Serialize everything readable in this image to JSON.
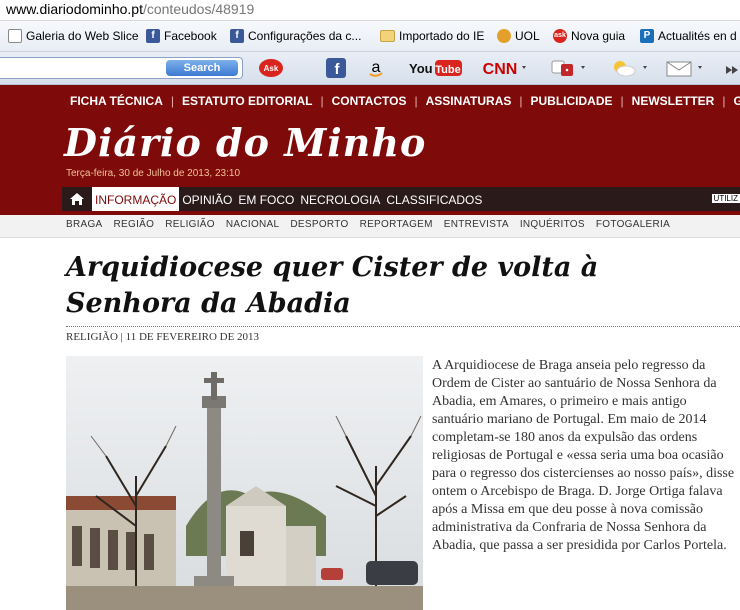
{
  "browser": {
    "url_domain": "www.diariodominho.pt",
    "url_path": "/conteudos/48919",
    "favorites": [
      {
        "label": "Galeria do Web Slice",
        "icon": "web-slice-icon"
      },
      {
        "label": "Facebook",
        "icon": "facebook-icon"
      },
      {
        "label": "Configurações da c...",
        "icon": "facebook-icon"
      },
      {
        "label": "Importado do IE",
        "icon": "folder-icon"
      },
      {
        "label": "UOL",
        "icon": "uol-icon"
      },
      {
        "label": "Nova guia",
        "icon": "ask-icon"
      },
      {
        "label": "Actualités en d",
        "icon": "p-icon"
      }
    ],
    "search_button": "Search",
    "ask_label": "Ask",
    "youtube_label": "YouTube",
    "cnn_label": "CNN"
  },
  "site": {
    "top_nav": [
      "FICHA TÉCNICA",
      "ESTATUTO EDITORIAL",
      "CONTACTOS",
      "ASSINATURAS",
      "PUBLICIDADE",
      "NEWSLETTER",
      "GR"
    ],
    "logo": "Diário do Minho",
    "date": "Terça-feira, 30 de Julho de 2013, 23:10",
    "main_nav": [
      "INFORMAÇÃO",
      "OPINIÃO",
      "EM FOCO",
      "NECROLOGIA",
      "CLASSIFICADOS"
    ],
    "utiliz_label": "UTILIZ",
    "sub_nav": [
      "BRAGA",
      "REGIÃO",
      "RELIGIÃO",
      "NACIONAL",
      "DESPORTO",
      "REPORTAGEM",
      "ENTREVISTA",
      "INQUÉRITOS",
      "FOTOGALERIA"
    ]
  },
  "article": {
    "title": "Arquidiocese quer Cister de volta à Senhora da Abadia",
    "meta": "RELIGIÃO | 11 DE FEVEREIRO DE 2013",
    "body": "A Arquidiocese de Braga anseia pelo regresso da Ordem de Cister ao santuário de Nossa Senhora da Abadia, em Amares, o primeiro e mais antigo santuário mariano de Portugal. Em maio de 2014 completam-se 180 anos da expulsão das ordens religiosas de Portugal e «essa seria uma boa ocasião para o regresso dos cistercienses ao nosso país», disse ontem o Arcebispo de Braga. D. Jorge Ortiga falava após a Missa em que deu posse à nova comissão administrativa da Confraria de Nossa Senhora da Abadia, que passa a ser presidida por Carlos Portela."
  }
}
